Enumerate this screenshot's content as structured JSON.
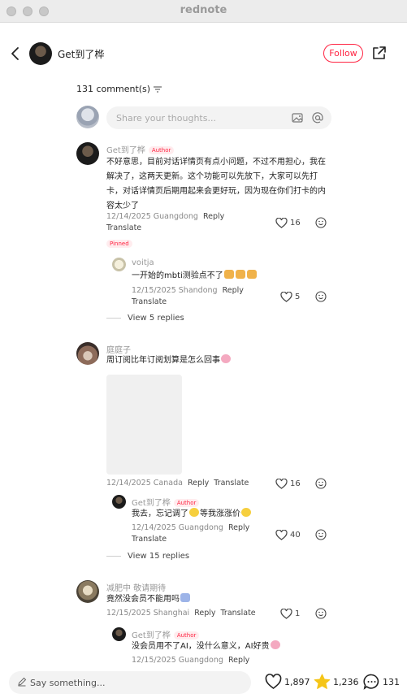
{
  "window": {
    "title": "rednote"
  },
  "header": {
    "author_name": "Get到了桦",
    "follow_label": "Follow"
  },
  "comments_header": {
    "count_label": "131 comment(s)"
  },
  "compose": {
    "placeholder": "Share your thoughts..."
  },
  "comments": [
    {
      "user": "Get到了桦",
      "badge": "Author",
      "text": "不好意思，目前对话详情页有点小问题，不过不用担心，我在解决了，这两天更新。这个功能可以先放下，大家可以先打卡，对话详情页后期用起来会更好玩，因为现在你们打卡的内容太少了",
      "meta": "12/14/2025 Guangdong",
      "reply_label": "Reply",
      "translate_label": "Translate",
      "likes": "16",
      "pinned_label": "Pinned",
      "replies": [
        {
          "user": "voitja",
          "text": "一开始的mbti测验点不了",
          "meta": "12/15/2025 Shandong",
          "reply_label": "Reply",
          "translate_label": "Translate",
          "likes": "5"
        }
      ],
      "view_replies": "View 5 replies"
    },
    {
      "user": "庭庭子",
      "text": "周订阅比年订阅划算是怎么回事",
      "meta": "12/14/2025 Canada",
      "reply_label": "Reply",
      "translate_label": "Translate",
      "likes": "16",
      "replies": [
        {
          "user": "Get到了桦",
          "badge": "Author",
          "text_a": "我去，忘记调了",
          "text_b": "等我涨涨价",
          "meta": "12/14/2025 Guangdong",
          "reply_label": "Reply",
          "translate_label": "Translate",
          "likes": "40"
        }
      ],
      "view_replies": "View 15 replies"
    },
    {
      "user": "减肥中 敬请期待",
      "text": "竟然没会员不能用吗",
      "meta": "12/15/2025 Shanghai",
      "reply_label": "Reply",
      "translate_label": "Translate",
      "likes": "1",
      "replies": [
        {
          "user": "Get到了桦",
          "badge": "Author",
          "text": "没会员用不了AI，没什么意义，AI好贵",
          "meta": "12/15/2025 Guangdong",
          "reply_label": "Reply"
        }
      ]
    }
  ],
  "bottom": {
    "say_placeholder": "Say something...",
    "likes": "1,897",
    "stars": "1,236",
    "comments": "131"
  },
  "colors": {
    "accent": "#ff2442",
    "star": "#f5c518"
  },
  "icons": [
    "back-icon",
    "share-icon",
    "sort-icon",
    "image-icon",
    "at-icon",
    "heart-icon",
    "face-icon",
    "pencil-icon",
    "star-icon",
    "comment-icon"
  ]
}
